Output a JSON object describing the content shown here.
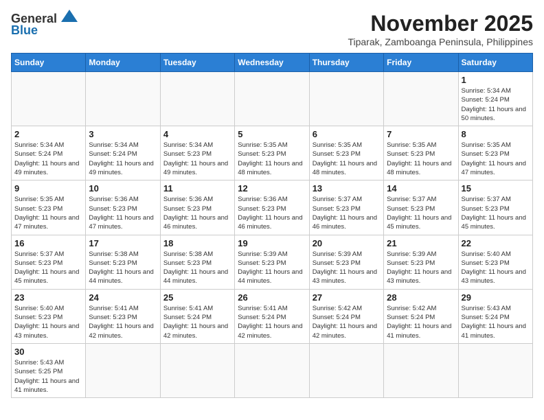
{
  "header": {
    "logo_line1": "General",
    "logo_line2": "Blue",
    "month": "November 2025",
    "location": "Tiparak, Zamboanga Peninsula, Philippines"
  },
  "weekdays": [
    "Sunday",
    "Monday",
    "Tuesday",
    "Wednesday",
    "Thursday",
    "Friday",
    "Saturday"
  ],
  "days": {
    "d1": {
      "n": "1",
      "sr": "5:34 AM",
      "ss": "5:24 PM",
      "dl": "11 hours and 50 minutes."
    },
    "d2": {
      "n": "2",
      "sr": "5:34 AM",
      "ss": "5:24 PM",
      "dl": "11 hours and 49 minutes."
    },
    "d3": {
      "n": "3",
      "sr": "5:34 AM",
      "ss": "5:24 PM",
      "dl": "11 hours and 49 minutes."
    },
    "d4": {
      "n": "4",
      "sr": "5:34 AM",
      "ss": "5:23 PM",
      "dl": "11 hours and 49 minutes."
    },
    "d5": {
      "n": "5",
      "sr": "5:35 AM",
      "ss": "5:23 PM",
      "dl": "11 hours and 48 minutes."
    },
    "d6": {
      "n": "6",
      "sr": "5:35 AM",
      "ss": "5:23 PM",
      "dl": "11 hours and 48 minutes."
    },
    "d7": {
      "n": "7",
      "sr": "5:35 AM",
      "ss": "5:23 PM",
      "dl": "11 hours and 48 minutes."
    },
    "d8": {
      "n": "8",
      "sr": "5:35 AM",
      "ss": "5:23 PM",
      "dl": "11 hours and 47 minutes."
    },
    "d9": {
      "n": "9",
      "sr": "5:35 AM",
      "ss": "5:23 PM",
      "dl": "11 hours and 47 minutes."
    },
    "d10": {
      "n": "10",
      "sr": "5:36 AM",
      "ss": "5:23 PM",
      "dl": "11 hours and 47 minutes."
    },
    "d11": {
      "n": "11",
      "sr": "5:36 AM",
      "ss": "5:23 PM",
      "dl": "11 hours and 46 minutes."
    },
    "d12": {
      "n": "12",
      "sr": "5:36 AM",
      "ss": "5:23 PM",
      "dl": "11 hours and 46 minutes."
    },
    "d13": {
      "n": "13",
      "sr": "5:37 AM",
      "ss": "5:23 PM",
      "dl": "11 hours and 46 minutes."
    },
    "d14": {
      "n": "14",
      "sr": "5:37 AM",
      "ss": "5:23 PM",
      "dl": "11 hours and 45 minutes."
    },
    "d15": {
      "n": "15",
      "sr": "5:37 AM",
      "ss": "5:23 PM",
      "dl": "11 hours and 45 minutes."
    },
    "d16": {
      "n": "16",
      "sr": "5:37 AM",
      "ss": "5:23 PM",
      "dl": "11 hours and 45 minutes."
    },
    "d17": {
      "n": "17",
      "sr": "5:38 AM",
      "ss": "5:23 PM",
      "dl": "11 hours and 44 minutes."
    },
    "d18": {
      "n": "18",
      "sr": "5:38 AM",
      "ss": "5:23 PM",
      "dl": "11 hours and 44 minutes."
    },
    "d19": {
      "n": "19",
      "sr": "5:39 AM",
      "ss": "5:23 PM",
      "dl": "11 hours and 44 minutes."
    },
    "d20": {
      "n": "20",
      "sr": "5:39 AM",
      "ss": "5:23 PM",
      "dl": "11 hours and 43 minutes."
    },
    "d21": {
      "n": "21",
      "sr": "5:39 AM",
      "ss": "5:23 PM",
      "dl": "11 hours and 43 minutes."
    },
    "d22": {
      "n": "22",
      "sr": "5:40 AM",
      "ss": "5:23 PM",
      "dl": "11 hours and 43 minutes."
    },
    "d23": {
      "n": "23",
      "sr": "5:40 AM",
      "ss": "5:23 PM",
      "dl": "11 hours and 43 minutes."
    },
    "d24": {
      "n": "24",
      "sr": "5:41 AM",
      "ss": "5:23 PM",
      "dl": "11 hours and 42 minutes."
    },
    "d25": {
      "n": "25",
      "sr": "5:41 AM",
      "ss": "5:24 PM",
      "dl": "11 hours and 42 minutes."
    },
    "d26": {
      "n": "26",
      "sr": "5:41 AM",
      "ss": "5:24 PM",
      "dl": "11 hours and 42 minutes."
    },
    "d27": {
      "n": "27",
      "sr": "5:42 AM",
      "ss": "5:24 PM",
      "dl": "11 hours and 42 minutes."
    },
    "d28": {
      "n": "28",
      "sr": "5:42 AM",
      "ss": "5:24 PM",
      "dl": "11 hours and 41 minutes."
    },
    "d29": {
      "n": "29",
      "sr": "5:43 AM",
      "ss": "5:24 PM",
      "dl": "11 hours and 41 minutes."
    },
    "d30": {
      "n": "30",
      "sr": "5:43 AM",
      "ss": "5:25 PM",
      "dl": "11 hours and 41 minutes."
    }
  },
  "labels": {
    "sunrise": "Sunrise:",
    "sunset": "Sunset:",
    "daylight": "Daylight:"
  }
}
